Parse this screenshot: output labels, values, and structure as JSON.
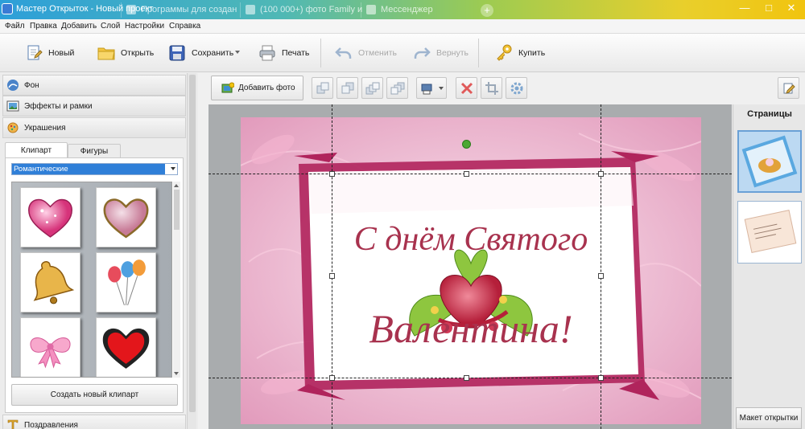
{
  "window": {
    "title": "Мастер Открыток - Новый проект",
    "browser_tabs": [
      {
        "label": "Программы для создан",
        "icon": "page-icon"
      },
      {
        "label": "(100 000+) фото Family и",
        "icon": "page-icon"
      },
      {
        "label": "Мессенджер",
        "icon": "messenger-icon"
      }
    ],
    "new_tab_label": "+",
    "controls": {
      "minimize": "—",
      "maximize": "□",
      "close": "✕"
    }
  },
  "menu": [
    "Файл",
    "Правка",
    "Добавить",
    "Слой",
    "Настройки",
    "Справка"
  ],
  "toolbar": {
    "new": "Новый",
    "open": "Открыть",
    "save": "Сохранить",
    "print": "Печать",
    "undo": "Отменить",
    "redo": "Вернуть",
    "buy": "Купить"
  },
  "sidebar": {
    "sections": [
      {
        "label": "Фон",
        "icon": "background-icon"
      },
      {
        "label": "Эффекты и рамки",
        "icon": "effects-icon"
      },
      {
        "label": "Украшения",
        "icon": "decorations-icon"
      }
    ],
    "bottom_section": {
      "label": "Поздравления",
      "icon": "text-icon"
    },
    "tabs": [
      "Клипарт",
      "Фигуры"
    ],
    "active_tab": "Клипарт",
    "category": "Романтические",
    "clipart": [
      "pink-heart",
      "sparkle-heart",
      "bell",
      "balloons",
      "pink-bow",
      "red-heart"
    ],
    "create_clipart_label": "Создать новый клипарт"
  },
  "editor": {
    "add_photo_label": "Добавить фото",
    "card_text_line1": "С днём Святого",
    "card_text_line2": "Валентина!"
  },
  "pages": {
    "header": "Страницы",
    "layout_button": "Макет открытки"
  },
  "colors": {
    "accent": "#2f7fd8",
    "card_pink": "#e8a3c0",
    "card_frame": "#b0245c",
    "text_burgundy": "#a8324e"
  }
}
